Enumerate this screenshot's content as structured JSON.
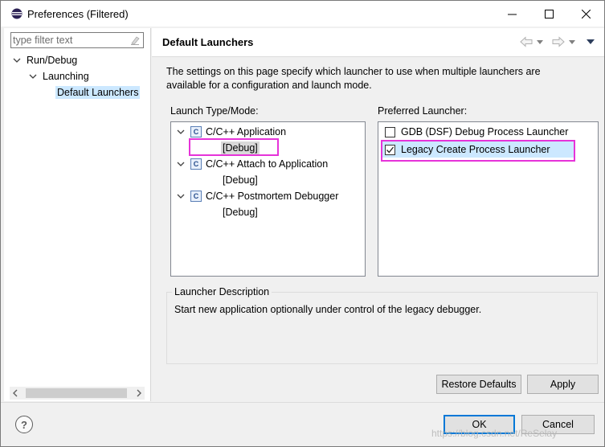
{
  "window": {
    "title": "Preferences (Filtered)"
  },
  "filter": {
    "placeholder": "type filter text"
  },
  "tree": {
    "items": [
      {
        "label": "Run/Debug"
      },
      {
        "label": "Launching"
      },
      {
        "label": "Default Launchers"
      }
    ]
  },
  "page": {
    "title": "Default Launchers",
    "description_line1": "The settings on this page specify which launcher to use when multiple launchers are",
    "description_line2": "available for a configuration and launch mode."
  },
  "launch_types": {
    "label": "Launch Type/Mode:",
    "items": [
      {
        "label": "C/C++ Application",
        "mode": "[Debug]"
      },
      {
        "label": "C/C++ Attach to Application",
        "mode": "[Debug]"
      },
      {
        "label": "C/C++ Postmortem Debugger",
        "mode": "[Debug]"
      }
    ]
  },
  "preferred": {
    "label": "Preferred Launcher:",
    "items": [
      {
        "label": "GDB (DSF) Debug Process Launcher",
        "checked": false
      },
      {
        "label": "Legacy Create Process Launcher",
        "checked": true
      }
    ]
  },
  "launcher_description": {
    "label": "Launcher Description",
    "text": "Start new application optionally under control of the legacy debugger."
  },
  "buttons": {
    "restore_defaults": "Restore Defaults",
    "apply": "Apply",
    "ok": "OK",
    "cancel": "Cancel",
    "help": "?"
  },
  "watermark": "https://blog.csdn.net/ReSelay",
  "colors": {
    "highlight_box": "#e633d9",
    "selection": "#cce8ff",
    "accent": "#0078d7"
  }
}
